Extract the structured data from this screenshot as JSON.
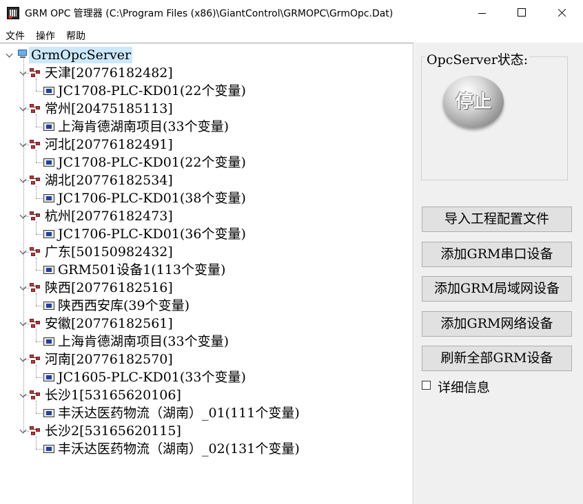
{
  "window": {
    "title": "GRM OPC 管理器  (C:\\Program Files (x86)\\GiantControl\\GRMOPC\\GrmOpc.Dat)"
  },
  "menu": [
    "文件",
    "操作",
    "帮助"
  ],
  "tree": {
    "root": "GrmOpcServer",
    "groups": [
      {
        "label": "天津[20776182482]",
        "device": "JC1708-PLC-KD01(22个变量)"
      },
      {
        "label": "常州[20475185113]",
        "device": "上海肯德湖南项目(33个变量)"
      },
      {
        "label": "河北[20776182491]",
        "device": "JC1708-PLC-KD01(22个变量)"
      },
      {
        "label": "湖北[20776182534]",
        "device": "JC1706-PLC-KD01(38个变量)"
      },
      {
        "label": "杭州[20776182473]",
        "device": "JC1706-PLC-KD01(36个变量)"
      },
      {
        "label": "广东[50150982432]",
        "device": "GRM501设备1(113个变量)"
      },
      {
        "label": "陕西[20776182516]",
        "device": "陕西西安库(39个变量)"
      },
      {
        "label": "安徽[20776182561]",
        "device": "上海肯德湖南项目(33个变量)"
      },
      {
        "label": "河南[20776182570]",
        "device": "JC1605-PLC-KD01(33个变量)"
      },
      {
        "label": "长沙1[53165620106]",
        "device": "丰沃达医药物流（湖南）_01(111个变量)"
      },
      {
        "label": "长沙2[53165620115]",
        "device": "丰沃达医药物流（湖南）_02(131个变量)"
      }
    ]
  },
  "status_panel": {
    "label": "OpcServer状态:",
    "state_text": "停止"
  },
  "actions": [
    "导入工程配置文件",
    "添加GRM串口设备",
    "添加GRM局域网设备",
    "添加GRM网络设备",
    "刷新全部GRM设备"
  ],
  "detail_checkbox": {
    "label": "详细信息",
    "checked": false
  }
}
